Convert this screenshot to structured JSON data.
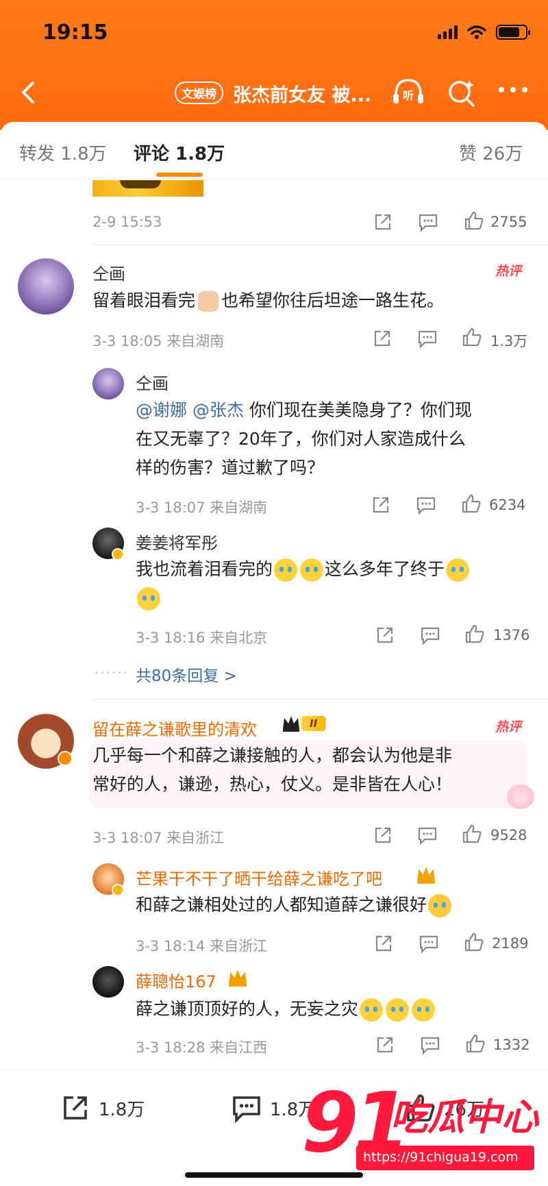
{
  "status": {
    "time": "19:15"
  },
  "nav": {
    "badge": "文娱榜",
    "title": "张杰前女友 被..."
  },
  "tabs": [
    {
      "label": "转发 1.8万"
    },
    {
      "label": "评论 1.8万"
    },
    {
      "label": "赞 26万"
    }
  ],
  "top_meta": {
    "time": "2-9 15:53",
    "likes": "2755"
  },
  "comments": [
    {
      "name": "仝画",
      "text": "留着眼泪看完",
      "text2": "也希望你往后坦途一路生花。",
      "meta": "3-3 18:05  来自湖南",
      "likes": "1.3万",
      "hot": "热评",
      "replies": [
        {
          "name": "仝画",
          "mention1": "@谢娜",
          "mention2": "@张杰",
          "line1": " 你们现在美美隐身了？你们现",
          "line2": "在又无辜了？20年了，你们对人家造成什么",
          "line3": "样的伤害？道过歉了吗？",
          "meta": "3-3 18:07  来自湖南",
          "likes": "6234"
        },
        {
          "name": "姜姜将军彤",
          "text": "我也流着泪看完的",
          "text2": "这么多年了终于",
          "meta": "3-3 18:16  来自北京",
          "likes": "1376"
        }
      ],
      "more_replies": "共80条回复 >"
    },
    {
      "name": "留在薛之谦歌里的清欢",
      "level": "II",
      "hot": "热评",
      "line1": "几乎每一个和薛之谦接触的人，都会认为他是非",
      "line2": "常好的人，谦逊，热心，仗义。是非皆在人心！",
      "meta": "3-3 18:07  来自浙江",
      "likes": "9528",
      "replies": [
        {
          "name": "芒果干不干了晒干给薛之谦吃了吧",
          "text": "和薛之谦相处过的人都知道薛之谦很好",
          "meta": "3-3 18:14  来自浙江",
          "likes": "2189"
        },
        {
          "name": "薛聰怡167",
          "text": "薛之谦顶顶好的人，无妄之灾",
          "meta": "3-3 18:28  来自江西",
          "likes": "1332"
        }
      ]
    }
  ],
  "bottom": {
    "repost": "1.8万",
    "comment": "1.8万",
    "like": "26万"
  },
  "watermark": {
    "big": "91",
    "cn": "吃瓜中心",
    "url": "https://91chigua19.com"
  },
  "colors": {
    "accent": "#ff6a10",
    "orange_name": "#f06a00",
    "link": "#3a6ea5"
  }
}
